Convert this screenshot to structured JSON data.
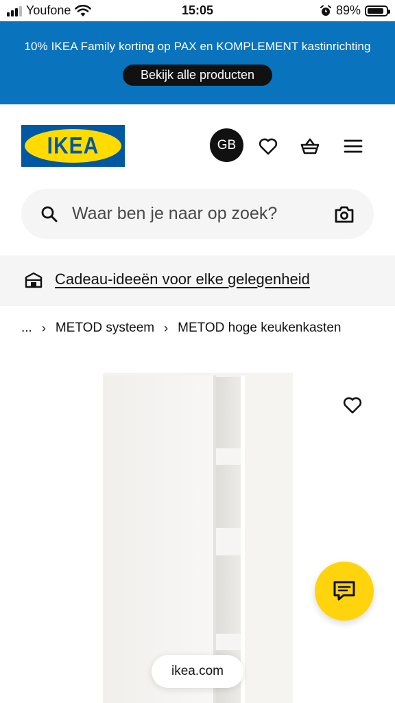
{
  "status_bar": {
    "carrier": "Youfone",
    "time": "15:05",
    "battery": "89%",
    "battery_level": 0.89,
    "icons": [
      "signal-icon",
      "wifi-icon",
      "alarm-icon",
      "battery-icon"
    ]
  },
  "promo": {
    "text": "10% IKEA Family korting op PAX en KOMPLEMENT kastinrichting",
    "button_label": "Bekijk alle producten",
    "background": "#0a73bd"
  },
  "header": {
    "logo_text": "IKEA",
    "avatar_initials": "GB",
    "icons": [
      "heart-icon",
      "basket-icon",
      "menu-icon"
    ]
  },
  "search": {
    "placeholder": "Waar ben je naar op zoek?",
    "value": ""
  },
  "gift_banner": {
    "link_text": "Cadeau-ideeën voor elke gelegenheid"
  },
  "breadcrumb": {
    "items": [
      "...",
      "METOD systeem",
      "METOD hoge keukenkasten"
    ]
  },
  "chat": {
    "color": "#ffd40c"
  },
  "browser": {
    "url": "ikea.com"
  }
}
